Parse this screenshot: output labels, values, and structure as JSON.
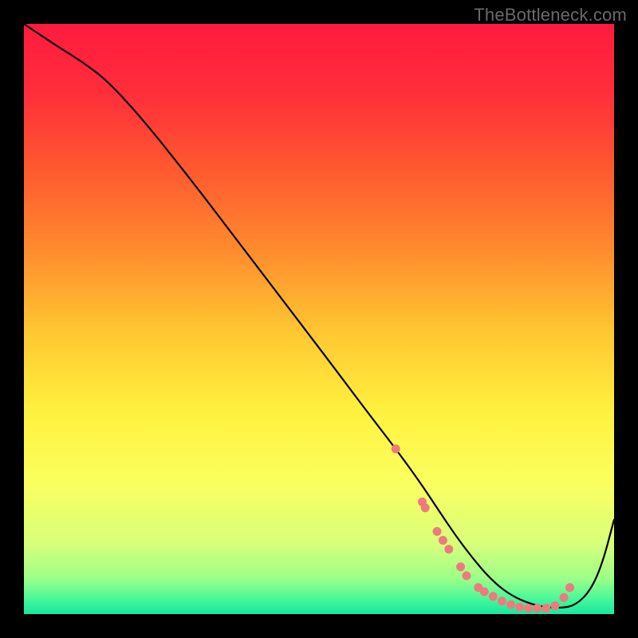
{
  "watermark": "TheBottleneck.com",
  "chart_data": {
    "type": "line",
    "title": "",
    "xlabel": "",
    "ylabel": "",
    "xlim": [
      0,
      100
    ],
    "ylim": [
      0,
      100
    ],
    "legend": false,
    "grid": false,
    "background_gradient": {
      "stops": [
        {
          "pos": 0.0,
          "color": "#ff1a3f"
        },
        {
          "pos": 0.12,
          "color": "#ff2f3a"
        },
        {
          "pos": 0.25,
          "color": "#ff5a2f"
        },
        {
          "pos": 0.38,
          "color": "#ff8a2e"
        },
        {
          "pos": 0.52,
          "color": "#ffc631"
        },
        {
          "pos": 0.66,
          "color": "#fff23f"
        },
        {
          "pos": 0.78,
          "color": "#faff60"
        },
        {
          "pos": 0.88,
          "color": "#d8ff7a"
        },
        {
          "pos": 0.94,
          "color": "#9cff89"
        },
        {
          "pos": 0.975,
          "color": "#47f79a"
        },
        {
          "pos": 1.0,
          "color": "#16e7a0"
        }
      ]
    },
    "series": [
      {
        "name": "bottleneck-curve",
        "color": "#000000",
        "x": [
          0,
          3,
          6,
          10,
          14,
          20,
          28,
          36,
          44,
          52,
          58,
          63,
          67,
          70,
          73,
          76,
          79,
          82,
          85,
          88,
          91,
          93.5,
          96,
          98,
          100
        ],
        "y": [
          100,
          98,
          96,
          93.5,
          90.5,
          84,
          74,
          63.5,
          53,
          42.5,
          34.5,
          28,
          22.5,
          18,
          13.5,
          9.5,
          6,
          3.5,
          2,
          1.2,
          1,
          1.5,
          4,
          8.5,
          16
        ]
      }
    ],
    "markers": {
      "name": "highlight-points",
      "color": "#ef7a7d",
      "radius": 5.5,
      "xy": [
        [
          63,
          28
        ],
        [
          67.5,
          19
        ],
        [
          68,
          18
        ],
        [
          70,
          14
        ],
        [
          71,
          12.5
        ],
        [
          72,
          11
        ],
        [
          74,
          8
        ],
        [
          75,
          6.5
        ],
        [
          77,
          4.5
        ],
        [
          78,
          3.8
        ],
        [
          79.5,
          3
        ],
        [
          81,
          2.2
        ],
        [
          82.5,
          1.6
        ],
        [
          84,
          1.2
        ],
        [
          85.5,
          1.0
        ],
        [
          87,
          1.0
        ],
        [
          88.5,
          1.0
        ],
        [
          90,
          1.4
        ],
        [
          91.5,
          2.8
        ],
        [
          92.5,
          4.5
        ]
      ]
    }
  }
}
